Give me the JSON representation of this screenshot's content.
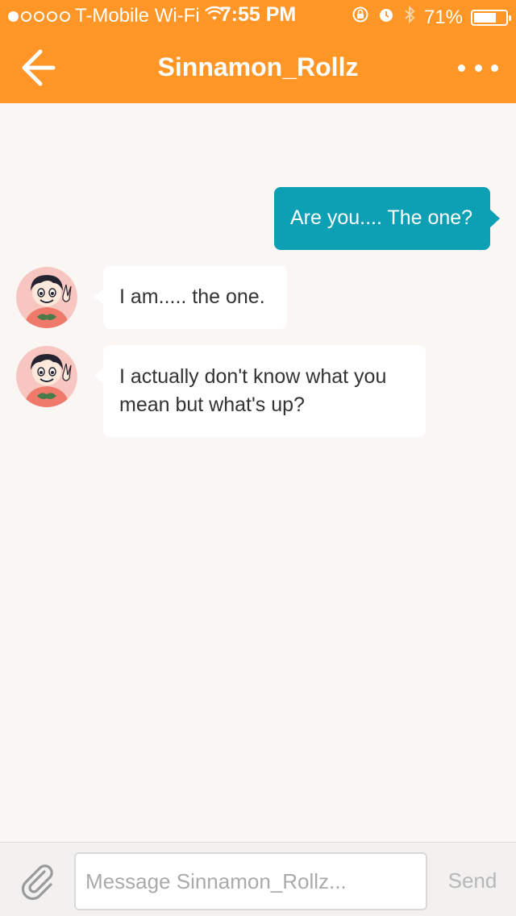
{
  "status_bar": {
    "carrier": "T-Mobile Wi-Fi",
    "time": "7:55 PM",
    "battery_percent": "71%",
    "battery_level": 0.71,
    "signal_bars_filled": 1,
    "signal_bars_total": 5,
    "icons": [
      "wifi-icon",
      "orientation-lock-icon",
      "alarm-icon",
      "bluetooth-icon",
      "battery-icon"
    ]
  },
  "nav": {
    "title": "Sinnamon_Rollz",
    "back_icon": "arrow-left-icon",
    "more_icon": "more-horizontal-icon"
  },
  "messages": [
    {
      "sender": "me",
      "text": "Are you.... The one?"
    },
    {
      "sender": "other",
      "text": "I am..... the one."
    },
    {
      "sender": "other",
      "text_line1": "I actually don't know what you",
      "text_line2": "mean but what's up?"
    }
  ],
  "compose": {
    "placeholder": "Message Sinnamon_Rollz...",
    "value": "",
    "send_label": "Send",
    "attach_icon": "paperclip-icon"
  },
  "colors": {
    "header": "#ff9626",
    "outgoing_bubble": "#0d9fb4",
    "incoming_bubble": "#ffffff",
    "background": "#faf6f3",
    "send_disabled": "#b7b7b7"
  }
}
